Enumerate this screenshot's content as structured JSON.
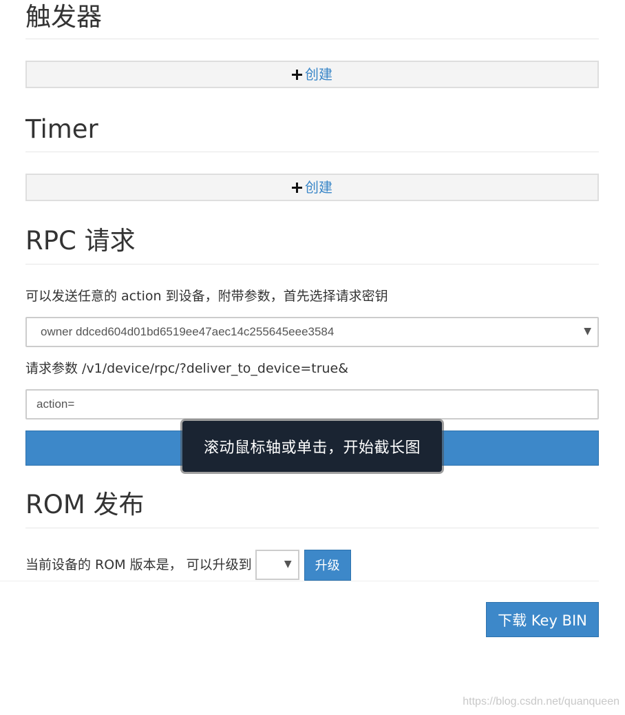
{
  "triggers": {
    "heading": "触发器",
    "create_label": "创建"
  },
  "timer": {
    "heading": "Timer",
    "create_label": "创建"
  },
  "rpc": {
    "heading": "RPC 请求",
    "description": "可以发送任意的 action 到设备，附带参数，首先选择请求密钥",
    "key_select_value": "owner ddced604d01bd6519ee47aec14c255645eee3584",
    "params_label": "请求参数 /v1/device/rpc/?deliver_to_device=true&",
    "params_input_value": "action="
  },
  "toast": {
    "text": "滚动鼠标轴或单击，开始截长图"
  },
  "rom": {
    "heading": "ROM 发布",
    "current_version_text": "当前设备的 ROM 版本是， 可以升级到",
    "upgrade_button_label": "升级"
  },
  "download_key_button_label": "下载 Key BIN",
  "watermark_text": "https://blog.csdn.net/quanqueen",
  "colors": {
    "primary": "#3d88c9",
    "link": "#3b87c8",
    "toast_bg": "#1a2432"
  }
}
